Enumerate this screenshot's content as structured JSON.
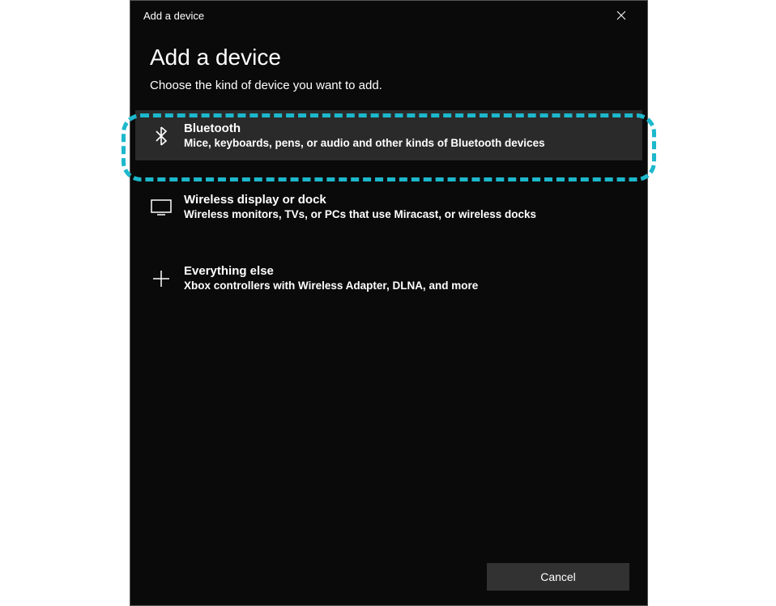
{
  "titlebar": {
    "title": "Add a device"
  },
  "heading": "Add a device",
  "subheading": "Choose the kind of device you want to add.",
  "options": [
    {
      "title": "Bluetooth",
      "desc": "Mice, keyboards, pens, or audio and other kinds of Bluetooth devices"
    },
    {
      "title": "Wireless display or dock",
      "desc": "Wireless monitors, TVs, or PCs that use Miracast, or wireless docks"
    },
    {
      "title": "Everything else",
      "desc": "Xbox controllers with Wireless Adapter, DLNA, and more"
    }
  ],
  "footer": {
    "cancel": "Cancel"
  }
}
